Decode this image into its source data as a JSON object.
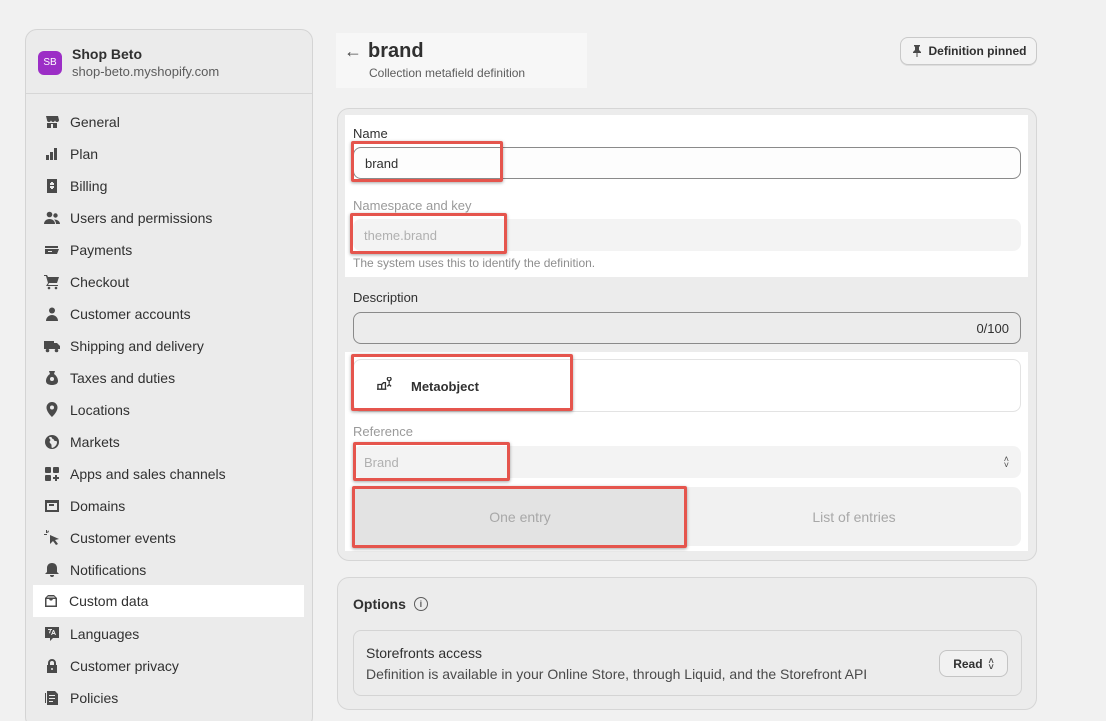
{
  "shop": {
    "initials": "SB",
    "name": "Shop Beto",
    "domain": "shop-beto.myshopify.com",
    "avatar_color": "#9c2ec6"
  },
  "sidebar": {
    "items": [
      {
        "label": "General",
        "icon": "store-icon"
      },
      {
        "label": "Plan",
        "icon": "chart-icon"
      },
      {
        "label": "Billing",
        "icon": "billing-icon"
      },
      {
        "label": "Users and permissions",
        "icon": "users-icon"
      },
      {
        "label": "Payments",
        "icon": "payments-icon"
      },
      {
        "label": "Checkout",
        "icon": "cart-icon"
      },
      {
        "label": "Customer accounts",
        "icon": "person-icon"
      },
      {
        "label": "Shipping and delivery",
        "icon": "truck-icon"
      },
      {
        "label": "Taxes and duties",
        "icon": "tax-icon"
      },
      {
        "label": "Locations",
        "icon": "location-icon"
      },
      {
        "label": "Markets",
        "icon": "globe-icon"
      },
      {
        "label": "Apps and sales channels",
        "icon": "apps-icon"
      },
      {
        "label": "Domains",
        "icon": "domain-icon"
      },
      {
        "label": "Customer events",
        "icon": "cursor-icon"
      },
      {
        "label": "Notifications",
        "icon": "bell-icon"
      },
      {
        "label": "Custom data",
        "icon": "custom-data-icon",
        "active": true
      },
      {
        "label": "Languages",
        "icon": "language-icon"
      },
      {
        "label": "Customer privacy",
        "icon": "lock-icon"
      },
      {
        "label": "Policies",
        "icon": "policy-icon"
      }
    ]
  },
  "header": {
    "title": "brand",
    "subtitle": "Collection metafield definition",
    "pin_label": "Definition pinned"
  },
  "form": {
    "name_label": "Name",
    "name_value": "brand",
    "namespace_label": "Namespace and key",
    "namespace_value": "theme.brand",
    "namespace_help": "The system uses this to identify the definition.",
    "description_label": "Description",
    "description_counter": "0/100",
    "type_label": "Metaobject",
    "reference_label": "Reference",
    "reference_value": "Brand",
    "segment": [
      "One entry",
      "List of entries"
    ],
    "segment_selected": "One entry"
  },
  "options": {
    "title": "Options",
    "storefront_title": "Storefronts access",
    "storefront_desc": "Definition is available in your Online Store, through Liquid, and the Storefront API",
    "access_value": "Read"
  },
  "colors": {
    "highlight_border": "#e5554d",
    "background": "#f1f1f1"
  }
}
